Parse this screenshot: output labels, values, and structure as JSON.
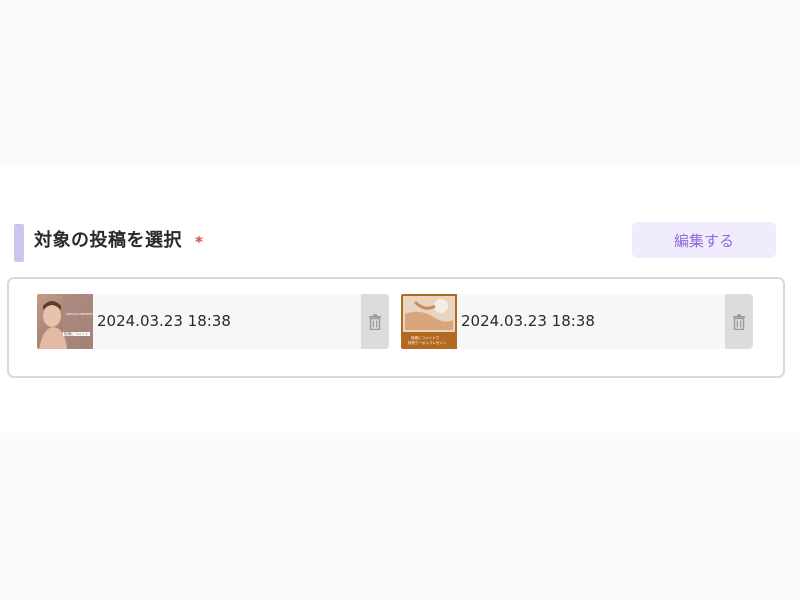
{
  "section": {
    "title": "対象の投稿を選択",
    "required_mark": "*"
  },
  "edit_button": {
    "label": "編集する"
  },
  "posts": [
    {
      "date": "2024.03.23 18:38",
      "thumbnail_caption": "投稿にコメント",
      "thumbnail_heading": "SPECIAL PRESENT",
      "delete_icon": "trash-icon"
    },
    {
      "date": "2024.03.23 18:38",
      "thumbnail_caption_line1": "投稿にコメントで",
      "thumbnail_caption_line2": "特別クーポンプレゼント",
      "delete_icon": "trash-icon"
    }
  ],
  "colors": {
    "accent_bar": "#cfc3f0",
    "edit_button_bg": "#f1ecfd",
    "edit_button_text": "#8e6ad6",
    "required": "#e0443c"
  }
}
